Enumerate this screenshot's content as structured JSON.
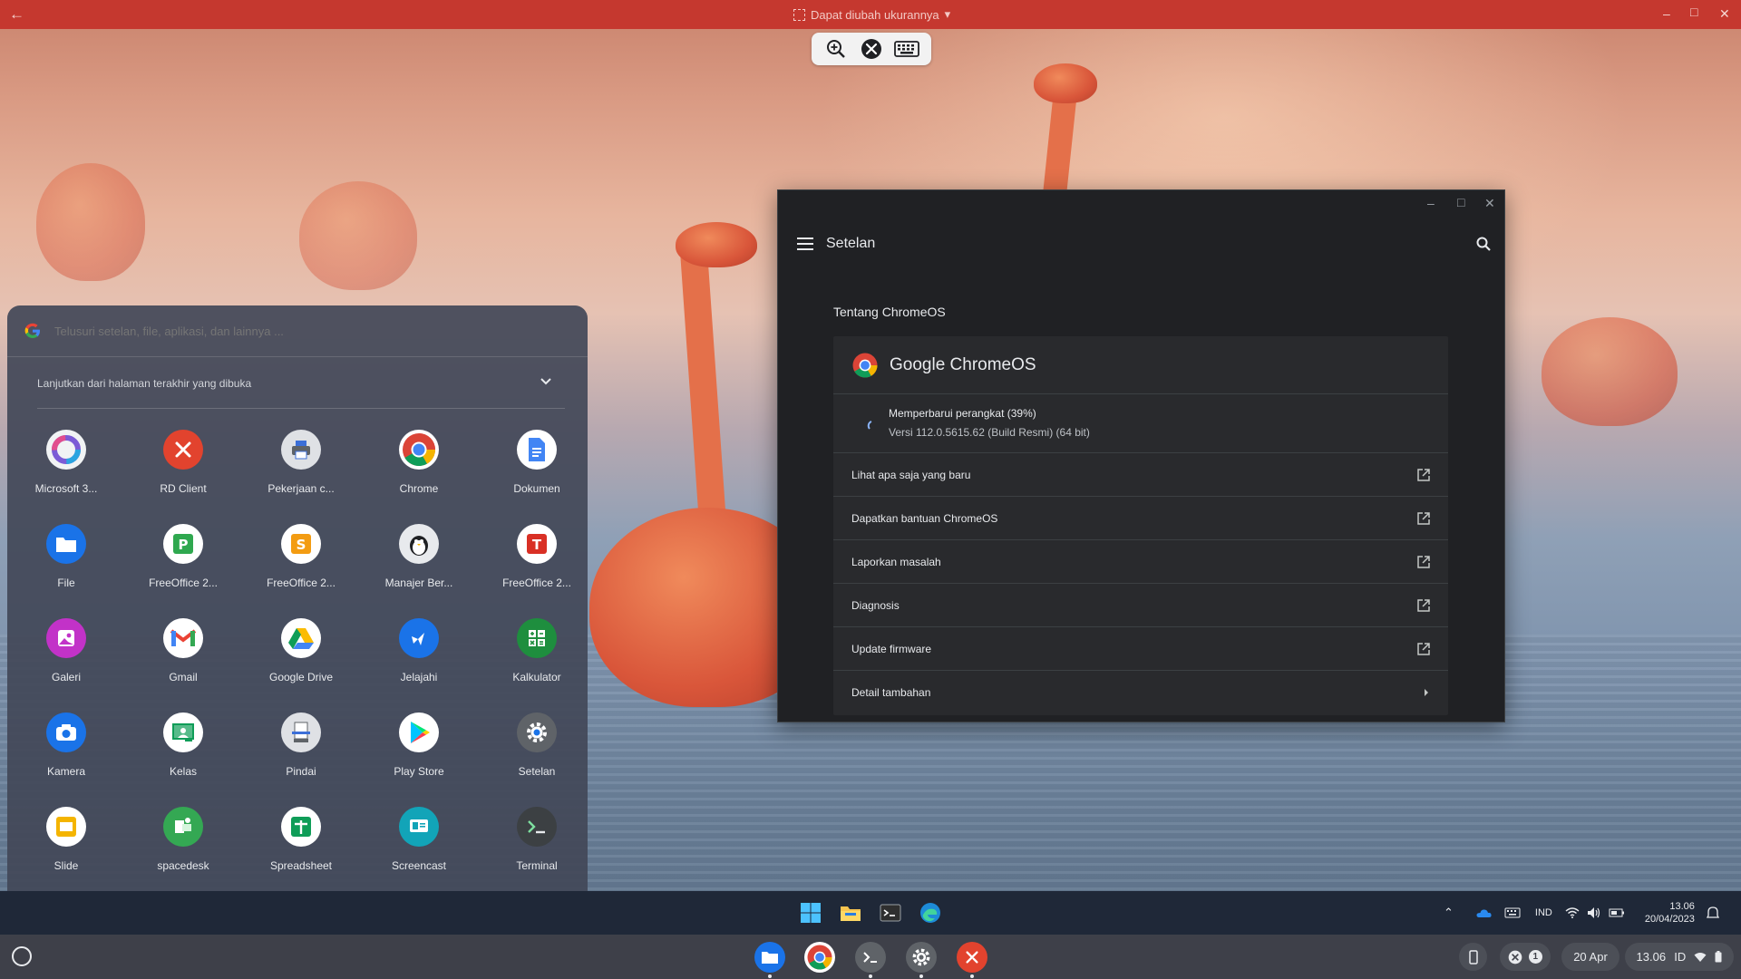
{
  "topbar": {
    "title": "Dapat diubah ukurannya",
    "accent": "#c5382f"
  },
  "remote_toolbar": {
    "icons": [
      "zoom-in-icon",
      "rd-client-icon",
      "keyboard-icon"
    ]
  },
  "launcher": {
    "search_placeholder": "Telusuri setelan, file, aplikasi, dan lainnya ...",
    "continue_label": "Lanjutkan dari halaman terakhir yang dibuka",
    "apps": [
      {
        "label": "Microsoft 3...",
        "icon": "microsoft-365-icon"
      },
      {
        "label": "RD Client",
        "icon": "rd-client-icon"
      },
      {
        "label": "Pekerjaan c...",
        "icon": "print-jobs-icon"
      },
      {
        "label": "Chrome",
        "icon": "chrome-icon"
      },
      {
        "label": "Dokumen",
        "icon": "docs-icon"
      },
      {
        "label": "File",
        "icon": "files-icon"
      },
      {
        "label": "FreeOffice 2...",
        "icon": "freeoffice-presentations-icon"
      },
      {
        "label": "FreeOffice 2...",
        "icon": "freeoffice-planmaker-icon"
      },
      {
        "label": "Manajer Ber...",
        "icon": "file-manager-icon"
      },
      {
        "label": "FreeOffice 2...",
        "icon": "freeoffice-textmaker-icon"
      },
      {
        "label": "Galeri",
        "icon": "gallery-icon"
      },
      {
        "label": "Gmail",
        "icon": "gmail-icon"
      },
      {
        "label": "Google Drive",
        "icon": "google-drive-icon"
      },
      {
        "label": "Jelajahi",
        "icon": "explore-icon"
      },
      {
        "label": "Kalkulator",
        "icon": "calculator-icon"
      },
      {
        "label": "Kamera",
        "icon": "camera-icon"
      },
      {
        "label": "Kelas",
        "icon": "classroom-icon"
      },
      {
        "label": "Pindai",
        "icon": "scan-icon"
      },
      {
        "label": "Play Store",
        "icon": "play-store-icon"
      },
      {
        "label": "Setelan",
        "icon": "settings-icon"
      },
      {
        "label": "Slide",
        "icon": "slides-icon"
      },
      {
        "label": "spacedesk",
        "icon": "spacedesk-icon"
      },
      {
        "label": "Spreadsheet",
        "icon": "sheets-icon"
      },
      {
        "label": "Screencast",
        "icon": "screencast-icon"
      },
      {
        "label": "Terminal",
        "icon": "terminal-icon"
      }
    ]
  },
  "settings": {
    "title": "Setelan",
    "section_title": "Tentang ChromeOS",
    "os_name": "Google ChromeOS",
    "update_status": "Memperbarui perangkat (39%)",
    "update_progress": 39,
    "version": "Versi 112.0.5615.62 (Build Resmi) (64 bit)",
    "rows": [
      {
        "label": "Lihat apa saja yang baru",
        "icon": "open-external-icon"
      },
      {
        "label": "Dapatkan bantuan ChromeOS",
        "icon": "open-external-icon"
      },
      {
        "label": "Laporkan masalah",
        "icon": "open-external-icon"
      },
      {
        "label": "Diagnosis",
        "icon": "open-external-icon"
      },
      {
        "label": "Update firmware",
        "icon": "open-external-icon"
      },
      {
        "label": "Detail tambahan",
        "icon": "chevron-right-icon"
      }
    ]
  },
  "win_taskbar": {
    "lang": "IND",
    "time": "13.06",
    "date": "20/04/2023"
  },
  "shelf": {
    "notification_count": "1",
    "date": "20 Apr",
    "time": "13.06",
    "region": "ID"
  }
}
